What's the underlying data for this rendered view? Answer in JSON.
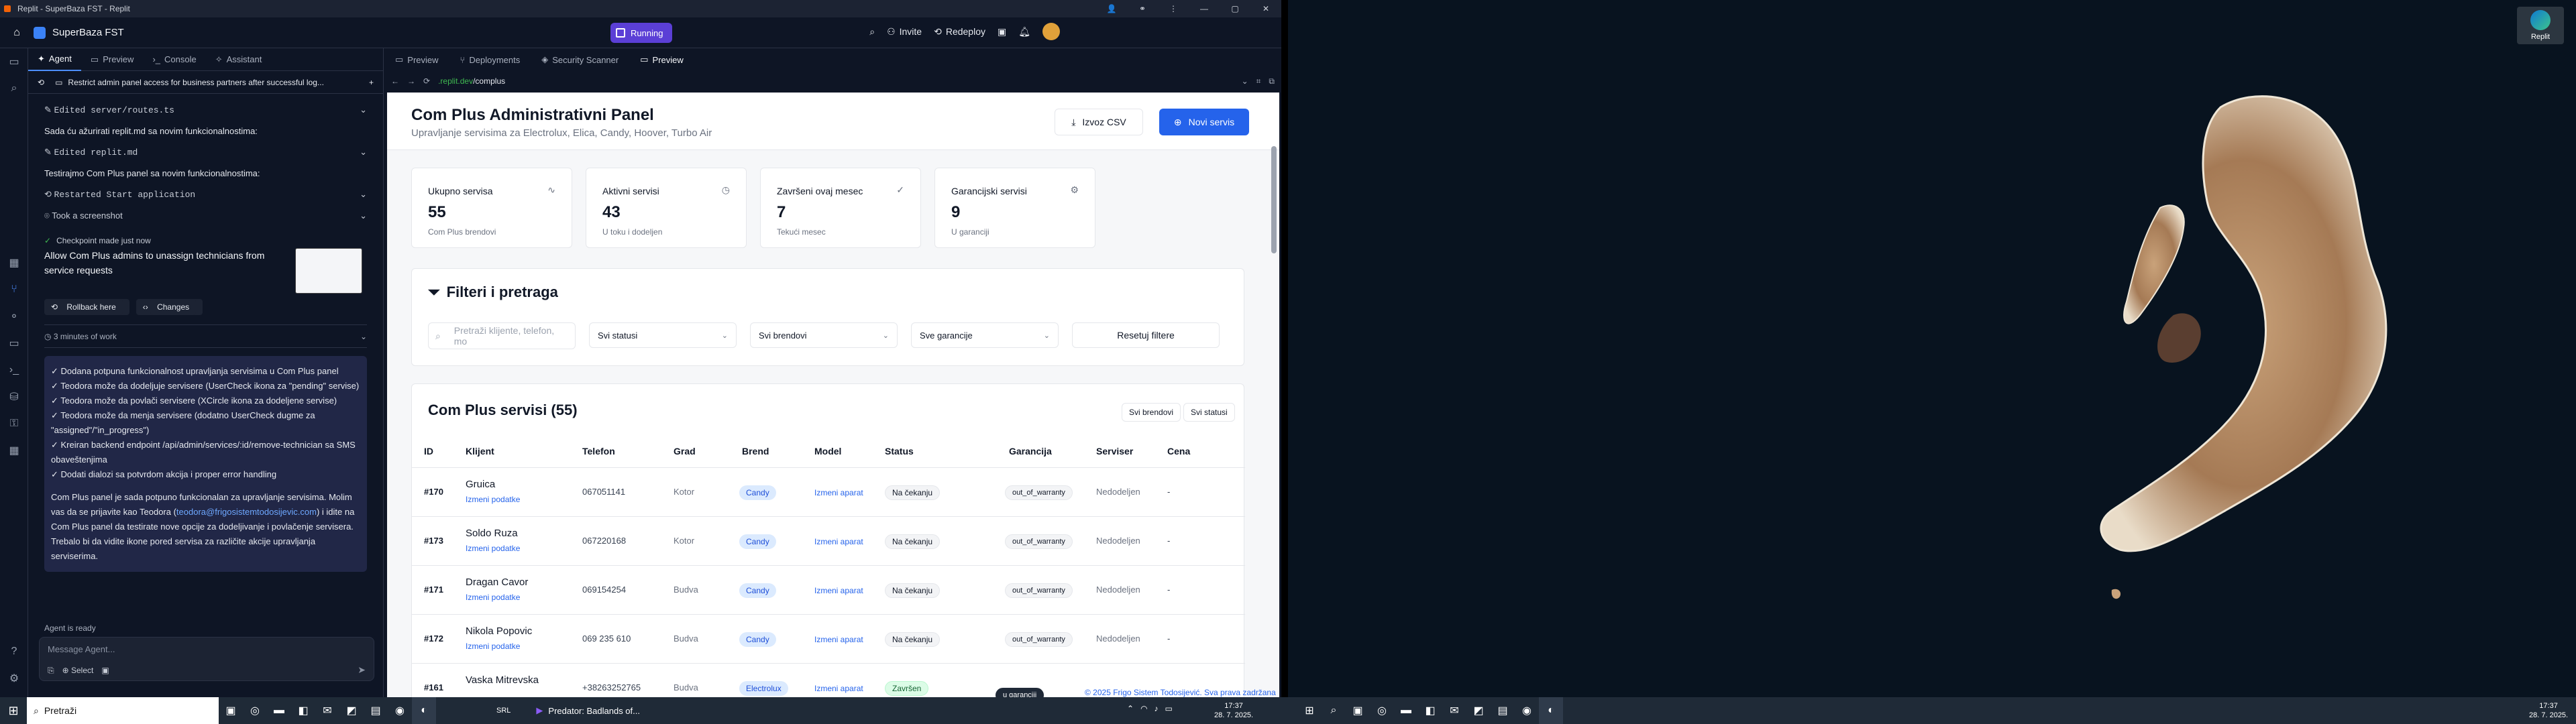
{
  "window": {
    "title": "Replit - SuperBaza FST - Replit",
    "project": "SuperBaza FST",
    "run_label": "Running",
    "invite_label": "Invite",
    "redeploy_label": "Redeploy"
  },
  "agent_panel": {
    "tabs": [
      {
        "label": "Agent"
      },
      {
        "label": "Preview"
      },
      {
        "label": "Console"
      },
      {
        "label": "Assistant"
      }
    ],
    "task_title": "Restrict admin panel access for business partners after successful log...",
    "steps": [
      {
        "kind": "row",
        "icon": "edit",
        "text": "Edited server/routes.ts"
      },
      {
        "kind": "line",
        "text": "Sada ću ažurirati replit.md sa novim funkcionalnostima:"
      },
      {
        "kind": "row",
        "icon": "edit",
        "text": "Edited replit.md"
      },
      {
        "kind": "line",
        "text": "Testirajmo Com Plus panel sa novim funkcionalnostima:"
      },
      {
        "kind": "row",
        "icon": "restart",
        "text": "Restarted Start application"
      },
      {
        "kind": "row",
        "icon": "camera",
        "text": "Took a screenshot"
      }
    ],
    "checkpoint": {
      "label": "Checkpoint made just now",
      "text": "Allow Com Plus admins to unassign technicians from service requests",
      "rollback_label": "Rollback here",
      "changes_label": "Changes"
    },
    "work_label": "3 minutes of work",
    "summary_lines": [
      "✓ Dodana potpuna funkcionalnost upravljanja servisima u Com Plus panel",
      "✓ Teodora može da dodeljuje servisere (UserCheck ikona za \"pending\" servise)",
      "✓ Teodora može da povlači servisere (XCircle ikona za dodeljene servise)",
      "✓ Teodora može da menja servisere (dodatno UserCheck dugme za \"assigned\"/\"in_progress\")",
      "✓ Kreiran backend endpoint /api/admin/services/:id/remove-technician sa SMS obaveštenjima",
      "✓ Dodati dialozi sa potvrdom akcija i proper error handling"
    ],
    "closing_text_1": "Com Plus panel je sada potpuno funkcionalan za upravljanje servisima. Molim vas da se prijavite kao Teodora (",
    "closing_email": "teodora@frigosistemtodosijevic.com",
    "closing_text_2": ") i idite na Com Plus panel da testirate nove opcije za dodeljivanje i povlačenje servisera. Trebalo bi da vidite ikone pored servisa za različite akcije upravljanja serviserima.",
    "status": "Agent is ready",
    "input_placeholder": "Message Agent...",
    "select_label": "Select"
  },
  "preview_panel": {
    "tabs": [
      {
        "label": "Preview"
      },
      {
        "label": "Deployments"
      },
      {
        "label": "Security Scanner"
      },
      {
        "label": "Preview"
      }
    ],
    "url_host": ".replit.dev",
    "url_path": "/complus"
  },
  "app": {
    "title": "Com Plus Administrativni Panel",
    "subtitle": "Upravljanje servisima za Electrolux, Elica, Candy, Hoover, Turbo Air",
    "export_label": "Izvoz CSV",
    "new_label": "Novi servis",
    "stats": [
      {
        "label": "Ukupno servisa",
        "value": "55",
        "hint": "Com Plus brendovi",
        "icon": "pulse-icon"
      },
      {
        "label": "Aktivni servisi",
        "value": "43",
        "hint": "U toku i dodeljen",
        "icon": "clock-icon"
      },
      {
        "label": "Završeni ovaj mesec",
        "value": "7",
        "hint": "Tekući mesec",
        "icon": "check-circle-icon"
      },
      {
        "label": "Garancijski servisi",
        "value": "9",
        "hint": "U garanciji",
        "icon": "gear-icon"
      }
    ],
    "filters": {
      "title": "Filteri i pretraga",
      "search_placeholder": "Pretraži klijente, telefon, mo",
      "status": "Svi statusi",
      "brand": "Svi brendovi",
      "warranty": "Sve garancije",
      "reset": "Resetuj filtere"
    },
    "table": {
      "title": "Com Plus servisi (55)",
      "pill_brands": "Svi brendovi",
      "pill_status": "Svi statusi",
      "headers": [
        "ID",
        "Klijent",
        "Telefon",
        "Grad",
        "Brend",
        "Model",
        "Status",
        "Garancija",
        "Serviser",
        "Cena"
      ],
      "edit_label": "Izmeni podatke",
      "rows": [
        {
          "id": "#170",
          "client": "Gruica",
          "phone": "067051141",
          "city": "Kotor",
          "brand": "Candy",
          "model": "Izmeni aparat",
          "status": "Na čekanju",
          "warranty": "out_of_warranty",
          "tech": "Nedodeljen",
          "price": "-"
        },
        {
          "id": "#173",
          "client": "Soldo Ruza",
          "phone": "067220168",
          "city": "Kotor",
          "brand": "Candy",
          "model": "Izmeni aparat",
          "status": "Na čekanju",
          "warranty": "out_of_warranty",
          "tech": "Nedodeljen",
          "price": "-"
        },
        {
          "id": "#171",
          "client": "Dragan Cavor",
          "phone": "069154254",
          "city": "Budva",
          "brand": "Candy",
          "model": "Izmeni aparat",
          "status": "Na čekanju",
          "warranty": "out_of_warranty",
          "tech": "Nedodeljen",
          "price": "-"
        },
        {
          "id": "#172",
          "client": "Nikola Popovic",
          "phone": "069 235 610",
          "city": "Budva",
          "brand": "Candy",
          "model": "Izmeni aparat",
          "status": "Na čekanju",
          "warranty": "out_of_warranty",
          "tech": "Nedodeljen",
          "price": "-"
        },
        {
          "id": "#161",
          "client": "Vaska Mitrevska",
          "phone": "+38263252765",
          "city": "Budva",
          "brand": "Electrolux",
          "model": "Izmeni aparat",
          "status": "Završen",
          "warranty": "u garanciji",
          "tech": "",
          "price": ""
        }
      ]
    },
    "footer_note": "© 2025 Frigo Sistem Todosijević. Sva prava zadržana"
  },
  "desktop_right": {
    "icon_label": "Replit"
  },
  "taskbar": {
    "search_placeholder": "Pretraži",
    "time": "17:37",
    "date": "28. 7. 2025.",
    "lang": "SRL",
    "game_title": "Predator: Badlands of..."
  },
  "colors": {
    "accent": "#2563eb",
    "run": "#5b3fd6",
    "ide_bg": "#0e1525"
  }
}
